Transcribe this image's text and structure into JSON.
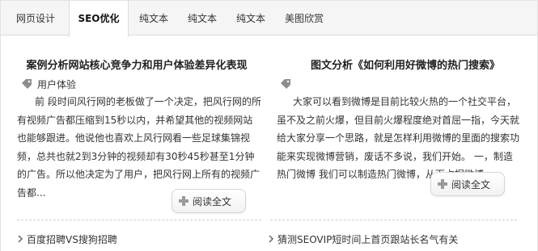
{
  "tabs": [
    {
      "label": "网页设计",
      "active": false
    },
    {
      "label": "SEO优化",
      "active": true
    },
    {
      "label": "纯文本",
      "active": false
    },
    {
      "label": "纯文本",
      "active": false
    },
    {
      "label": "纯文本",
      "active": false
    },
    {
      "label": "美图欣赏",
      "active": false
    }
  ],
  "left_post": {
    "title": "案例分析网站核心竞争力和用户体验差异化表现",
    "tag": "用户体验",
    "excerpt_lines": [
      "前 段时间风行网的老板做了一个决定，把风行网的所",
      "有视频广告都压缩到15秒以内，并希望其他的视频网站",
      "也能够跟进。他说他也喜欢上风行网看一些足球集锦视",
      "频，总共也就2到3分钟的视频却有30秒45秒甚至1分钟",
      "的广告。所以他决定为了用户，把风行网上所有的视频广",
      "告都..."
    ],
    "read_more": "阅读全文"
  },
  "right_post": {
    "title": "图文分析《如何利用好微博的热门搜索》",
    "tag": "",
    "excerpt_lines": [
      "大家可以看到微博是目前比较火热的一个社交平台，",
      "虽不及之前火爆，但目前火爆程度绝对首屈一指，今天就",
      "给大家分享一个思路，就是怎样利用微博的里面的搜索功",
      "能来实现微博营销，废话不多说，我们开始。 一，制造",
      "热门微博 我们可以制造热门微博，从而占据微博..."
    ],
    "read_more": "阅读全文"
  },
  "links": [
    {
      "text": "百度招聘VS搜狗招聘"
    },
    {
      "text": "猜测SEOVIP短时间上首页跟站长名气有关"
    }
  ],
  "icons": {
    "tag": "tag-icon",
    "read_more": "plus-icon",
    "link": "chevron-right-icon"
  },
  "colors": {
    "tab_bar_bg": "#f5f5f5",
    "text": "#333333",
    "icon_gray": "#9a9a9a",
    "divider": "#cccccc"
  }
}
